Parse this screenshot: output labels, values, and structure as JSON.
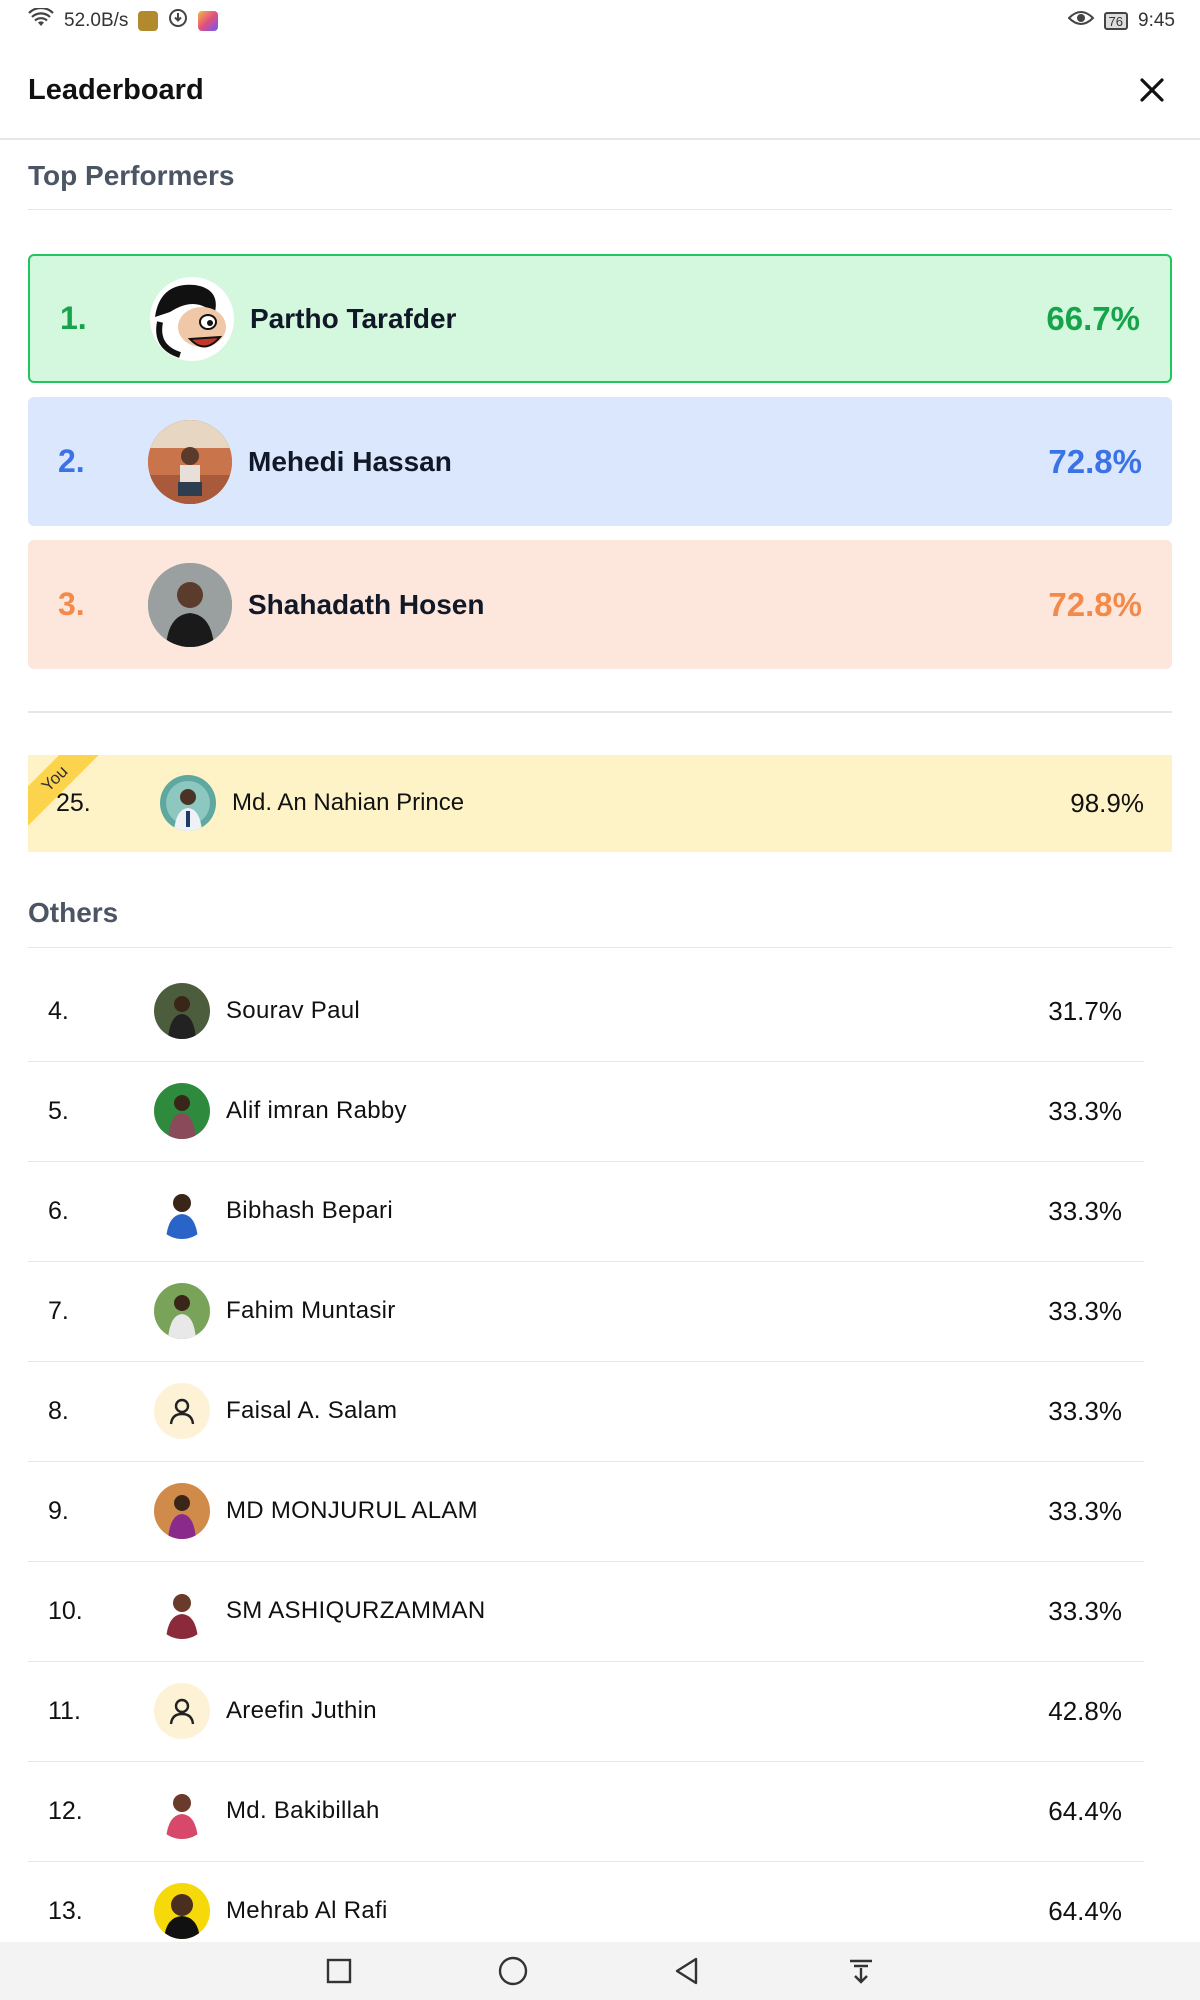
{
  "status_bar": {
    "network_speed": "52.0B/s",
    "battery": "76",
    "time": "9:45"
  },
  "header": {
    "title": "Leaderboard"
  },
  "top_section": {
    "title": "Top Performers",
    "items": [
      {
        "rank": "1.",
        "name": "Partho Tarafder",
        "score": "66.7%",
        "color": "#16a34a"
      },
      {
        "rank": "2.",
        "name": "Mehedi Hassan",
        "score": "72.8%",
        "color": "#3b73e6"
      },
      {
        "rank": "3.",
        "name": "Shahadath Hosen",
        "score": "72.8%",
        "color": "#f38a4a"
      }
    ]
  },
  "you": {
    "badge": "You",
    "rank": "25.",
    "name": "Md. An Nahian Prince",
    "score": "98.9%"
  },
  "others_section": {
    "title": "Others",
    "items": [
      {
        "rank": "4.",
        "name": "Sourav Paul",
        "score": "31.7%"
      },
      {
        "rank": "5.",
        "name": "Alif imran Rabby",
        "score": "33.3%"
      },
      {
        "rank": "6.",
        "name": "Bibhash Bepari",
        "score": "33.3%"
      },
      {
        "rank": "7.",
        "name": "Fahim Muntasir",
        "score": "33.3%"
      },
      {
        "rank": "8.",
        "name": "Faisal A. Salam",
        "score": "33.3%"
      },
      {
        "rank": "9.",
        "name": "MD MONJURUL ALAM",
        "score": "33.3%"
      },
      {
        "rank": "10.",
        "name": "SM ASHIQURZAMMAN",
        "score": "33.3%"
      },
      {
        "rank": "11.",
        "name": "Areefin Juthin",
        "score": "42.8%"
      },
      {
        "rank": "12.",
        "name": "Md. Bakibillah",
        "score": "64.4%"
      },
      {
        "rank": "13.",
        "name": "Mehrab Al Rafi",
        "score": "64.4%"
      }
    ]
  },
  "colors": {
    "rank1": "#16a34a",
    "rank2": "#3b73e6",
    "rank3": "#f38a4a",
    "you_bg": "#fef3c7"
  }
}
